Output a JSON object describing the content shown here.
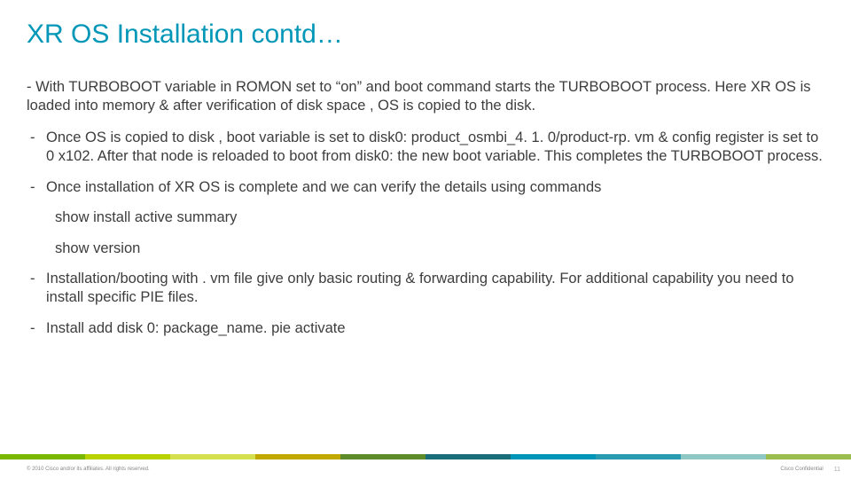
{
  "title": "XR OS Installation contd…",
  "para1": "- With TURBOBOOT variable in ROMON set to “on” and boot command starts the TURBOBOOT process. Here XR OS is loaded into memory & after verification of disk space , OS is copied to the disk.",
  "bullets": {
    "b1": "Once OS is copied to disk , boot variable is set to disk0: product_osmbi_4. 1. 0/product-rp. vm & config register is set to 0 x102. After that node is reloaded to boot from disk0: the new boot variable. This completes the TURBOBOOT process.",
    "b2": "Once installation of XR OS is complete and we can verify the details using commands",
    "b3": "Installation/booting with . vm file give only basic routing & forwarding capability. For additional capability you need to install specific PIE files.",
    "b4": "Install add  disk 0: package_name. pie activate"
  },
  "cmds": {
    "c1": "show install active summary",
    "c2": "show version"
  },
  "footer": {
    "left": "© 2010 Cisco and/or its affiliates. All rights reserved.",
    "conf": "Cisco Confidential",
    "page": "11"
  }
}
